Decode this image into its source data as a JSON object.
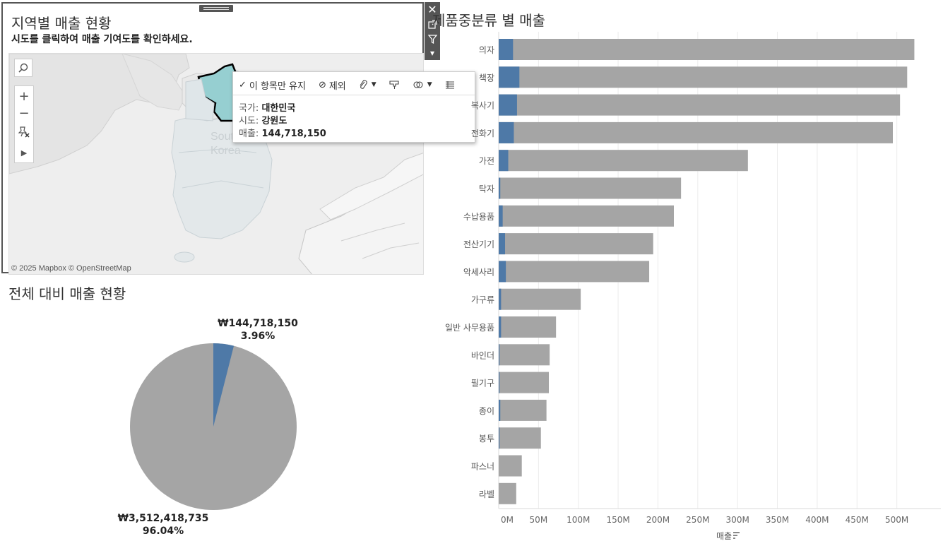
{
  "map": {
    "title": "지역별 매출 현황",
    "subtitle": "시도를 클릭하여 매출 기여도를 확인하세요.",
    "attribution": "© 2025 Mapbox © OpenStreetMap",
    "country_label": "South Korea",
    "highlight_color": "#96cfd1",
    "land_color": "#e3e8ea",
    "tools": {
      "search": "search-icon",
      "zoom_in": "+",
      "zoom_out": "−",
      "pin": "pin-icon",
      "expand": "▶"
    }
  },
  "toolbar": {
    "close": "✕",
    "popout": "⧉",
    "filter": "filter-icon",
    "more": "▾"
  },
  "tooltip": {
    "keep_only": "이 항목만 유지",
    "exclude": "제외",
    "country_label": "국가:",
    "country_value": "대한민국",
    "region_label": "시도:",
    "region_value": "강원도",
    "sales_label": "매출:",
    "sales_value": "144,718,150"
  },
  "pie": {
    "title": "전체 대비 매출 현황",
    "selected_amount": "₩144,718,150",
    "selected_pct": "3.96%",
    "rest_amount": "₩3,512,418,735",
    "rest_pct": "96.04%",
    "selected_color": "#4e79a7",
    "rest_color": "#a5a5a5",
    "fraction_selected": 0.0396
  },
  "bar": {
    "title": "제품중분류 별 매출",
    "x_axis_label": "매출",
    "ticks": [
      "0M",
      "50M",
      "100M",
      "150M",
      "200M",
      "250M",
      "300M",
      "350M",
      "400M",
      "450M",
      "500M"
    ],
    "selected_color": "#4e79a7",
    "total_color": "#a5a5a5"
  },
  "chart_data": {
    "type": "bar",
    "orientation": "horizontal",
    "title": "제품중분류 별 매출",
    "xlabel": "매출",
    "xlim": [
      0,
      550
    ],
    "unit": "M",
    "categories": [
      "의자",
      "책장",
      "복사기",
      "전화기",
      "가전",
      "탁자",
      "수납용품",
      "전산기기",
      "악세사리",
      "가구류",
      "일반 사무용품",
      "바인더",
      "필기구",
      "종이",
      "봉투",
      "파스너",
      "라벨"
    ],
    "series": [
      {
        "values": [
          522,
          513,
          504,
          495,
          313,
          229,
          220,
          194,
          189,
          103,
          72,
          64,
          63,
          60,
          53,
          29,
          22
        ]
      },
      {
        "values": [
          18,
          26,
          23,
          19,
          12,
          2,
          5,
          8,
          9,
          3,
          3,
          1,
          1,
          2,
          1,
          0,
          0
        ]
      }
    ]
  }
}
